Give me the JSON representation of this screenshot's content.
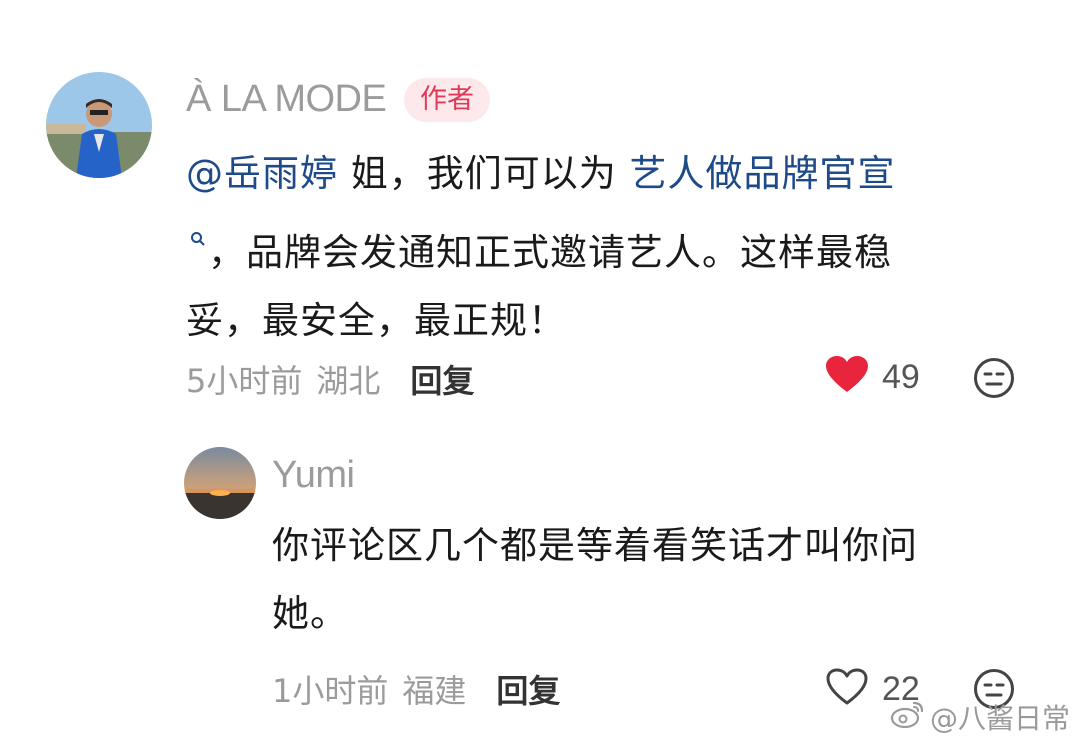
{
  "comments": [
    {
      "author": "À LA MODE",
      "badge": "作者",
      "mention": "@岳雨婷",
      "text_before_topic": " 姐，我们可以为 ",
      "topic": "艺人做品牌官宣",
      "text_after_topic": "，品牌会发通知正式邀请艺人。这样最稳",
      "text_line3": "妥，最安全，最正规！",
      "time": "5小时前",
      "location": "湖北",
      "reply_label": "回复",
      "likes": "49",
      "liked": true,
      "like_color": "#e8253d"
    },
    {
      "author": "Yumi",
      "text_line1": "你评论区几个都是等着看笑话才叫你问",
      "text_line2": "她。",
      "time": "1小时前",
      "location": "福建",
      "reply_label": "回复",
      "likes": "22",
      "liked": false
    }
  ],
  "watermark": "@八酱日常",
  "icons": {
    "like": "heart-icon",
    "emoji": "neutral-face-icon",
    "search": "search-icon",
    "weibo": "weibo-logo-icon"
  }
}
